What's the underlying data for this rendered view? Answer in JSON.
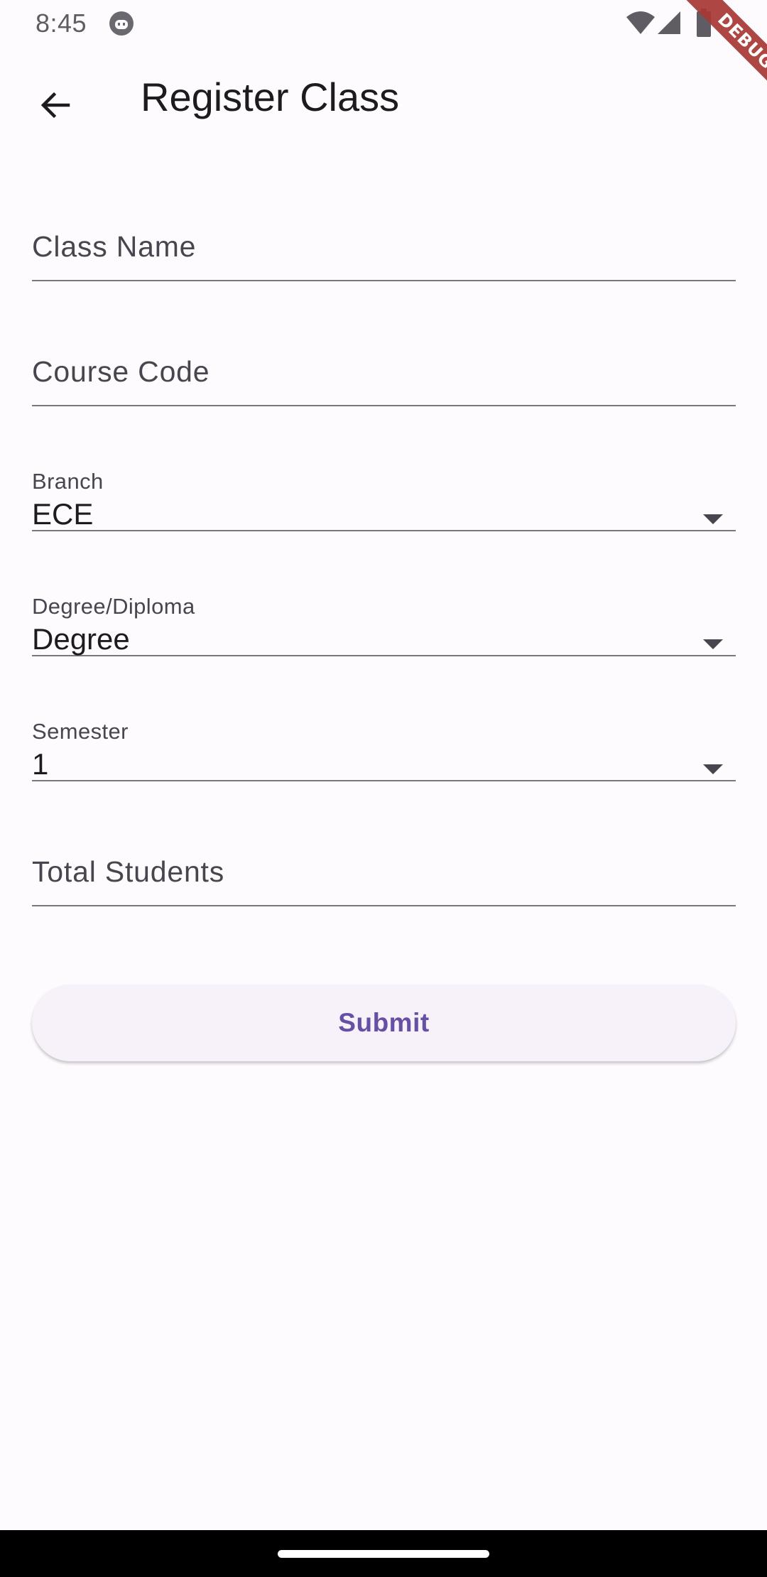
{
  "status_bar": {
    "time": "8:45",
    "icons": [
      "app-notification-icon",
      "wifi-icon",
      "cellular-signal-icon",
      "battery-icon"
    ]
  },
  "debug_banner": {
    "label": "DEBUG",
    "color": "#a83834"
  },
  "app_bar": {
    "back_icon": "arrow-back-icon",
    "title": "Register Class"
  },
  "form": {
    "class_name": {
      "placeholder": "Class Name",
      "value": ""
    },
    "course_code": {
      "placeholder": "Course Code",
      "value": ""
    },
    "branch": {
      "label": "Branch",
      "value": "ECE"
    },
    "degree_diploma": {
      "label": "Degree/Diploma",
      "value": "Degree"
    },
    "semester": {
      "label": "Semester",
      "value": "1"
    },
    "total_students": {
      "placeholder": "Total Students",
      "value": ""
    },
    "submit_label": "Submit"
  },
  "colors": {
    "background": "#fefbfe",
    "accent": "#6750a4",
    "underline": "#79767d",
    "button_surface": "#f7f2fa"
  }
}
